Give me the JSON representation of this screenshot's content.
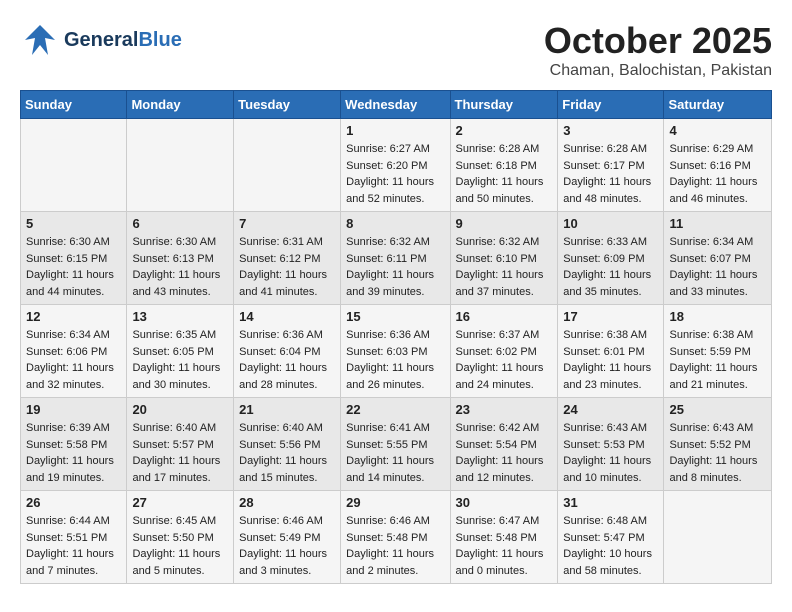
{
  "header": {
    "logo_general": "General",
    "logo_blue": "Blue",
    "month": "October 2025",
    "location": "Chaman, Balochistan, Pakistan"
  },
  "days_of_week": [
    "Sunday",
    "Monday",
    "Tuesday",
    "Wednesday",
    "Thursday",
    "Friday",
    "Saturday"
  ],
  "weeks": [
    [
      {
        "day": "",
        "info": ""
      },
      {
        "day": "",
        "info": ""
      },
      {
        "day": "",
        "info": ""
      },
      {
        "day": "1",
        "info": "Sunrise: 6:27 AM\nSunset: 6:20 PM\nDaylight: 11 hours and 52 minutes."
      },
      {
        "day": "2",
        "info": "Sunrise: 6:28 AM\nSunset: 6:18 PM\nDaylight: 11 hours and 50 minutes."
      },
      {
        "day": "3",
        "info": "Sunrise: 6:28 AM\nSunset: 6:17 PM\nDaylight: 11 hours and 48 minutes."
      },
      {
        "day": "4",
        "info": "Sunrise: 6:29 AM\nSunset: 6:16 PM\nDaylight: 11 hours and 46 minutes."
      }
    ],
    [
      {
        "day": "5",
        "info": "Sunrise: 6:30 AM\nSunset: 6:15 PM\nDaylight: 11 hours and 44 minutes."
      },
      {
        "day": "6",
        "info": "Sunrise: 6:30 AM\nSunset: 6:13 PM\nDaylight: 11 hours and 43 minutes."
      },
      {
        "day": "7",
        "info": "Sunrise: 6:31 AM\nSunset: 6:12 PM\nDaylight: 11 hours and 41 minutes."
      },
      {
        "day": "8",
        "info": "Sunrise: 6:32 AM\nSunset: 6:11 PM\nDaylight: 11 hours and 39 minutes."
      },
      {
        "day": "9",
        "info": "Sunrise: 6:32 AM\nSunset: 6:10 PM\nDaylight: 11 hours and 37 minutes."
      },
      {
        "day": "10",
        "info": "Sunrise: 6:33 AM\nSunset: 6:09 PM\nDaylight: 11 hours and 35 minutes."
      },
      {
        "day": "11",
        "info": "Sunrise: 6:34 AM\nSunset: 6:07 PM\nDaylight: 11 hours and 33 minutes."
      }
    ],
    [
      {
        "day": "12",
        "info": "Sunrise: 6:34 AM\nSunset: 6:06 PM\nDaylight: 11 hours and 32 minutes."
      },
      {
        "day": "13",
        "info": "Sunrise: 6:35 AM\nSunset: 6:05 PM\nDaylight: 11 hours and 30 minutes."
      },
      {
        "day": "14",
        "info": "Sunrise: 6:36 AM\nSunset: 6:04 PM\nDaylight: 11 hours and 28 minutes."
      },
      {
        "day": "15",
        "info": "Sunrise: 6:36 AM\nSunset: 6:03 PM\nDaylight: 11 hours and 26 minutes."
      },
      {
        "day": "16",
        "info": "Sunrise: 6:37 AM\nSunset: 6:02 PM\nDaylight: 11 hours and 24 minutes."
      },
      {
        "day": "17",
        "info": "Sunrise: 6:38 AM\nSunset: 6:01 PM\nDaylight: 11 hours and 23 minutes."
      },
      {
        "day": "18",
        "info": "Sunrise: 6:38 AM\nSunset: 5:59 PM\nDaylight: 11 hours and 21 minutes."
      }
    ],
    [
      {
        "day": "19",
        "info": "Sunrise: 6:39 AM\nSunset: 5:58 PM\nDaylight: 11 hours and 19 minutes."
      },
      {
        "day": "20",
        "info": "Sunrise: 6:40 AM\nSunset: 5:57 PM\nDaylight: 11 hours and 17 minutes."
      },
      {
        "day": "21",
        "info": "Sunrise: 6:40 AM\nSunset: 5:56 PM\nDaylight: 11 hours and 15 minutes."
      },
      {
        "day": "22",
        "info": "Sunrise: 6:41 AM\nSunset: 5:55 PM\nDaylight: 11 hours and 14 minutes."
      },
      {
        "day": "23",
        "info": "Sunrise: 6:42 AM\nSunset: 5:54 PM\nDaylight: 11 hours and 12 minutes."
      },
      {
        "day": "24",
        "info": "Sunrise: 6:43 AM\nSunset: 5:53 PM\nDaylight: 11 hours and 10 minutes."
      },
      {
        "day": "25",
        "info": "Sunrise: 6:43 AM\nSunset: 5:52 PM\nDaylight: 11 hours and 8 minutes."
      }
    ],
    [
      {
        "day": "26",
        "info": "Sunrise: 6:44 AM\nSunset: 5:51 PM\nDaylight: 11 hours and 7 minutes."
      },
      {
        "day": "27",
        "info": "Sunrise: 6:45 AM\nSunset: 5:50 PM\nDaylight: 11 hours and 5 minutes."
      },
      {
        "day": "28",
        "info": "Sunrise: 6:46 AM\nSunset: 5:49 PM\nDaylight: 11 hours and 3 minutes."
      },
      {
        "day": "29",
        "info": "Sunrise: 6:46 AM\nSunset: 5:48 PM\nDaylight: 11 hours and 2 minutes."
      },
      {
        "day": "30",
        "info": "Sunrise: 6:47 AM\nSunset: 5:48 PM\nDaylight: 11 hours and 0 minutes."
      },
      {
        "day": "31",
        "info": "Sunrise: 6:48 AM\nSunset: 5:47 PM\nDaylight: 10 hours and 58 minutes."
      },
      {
        "day": "",
        "info": ""
      }
    ]
  ]
}
